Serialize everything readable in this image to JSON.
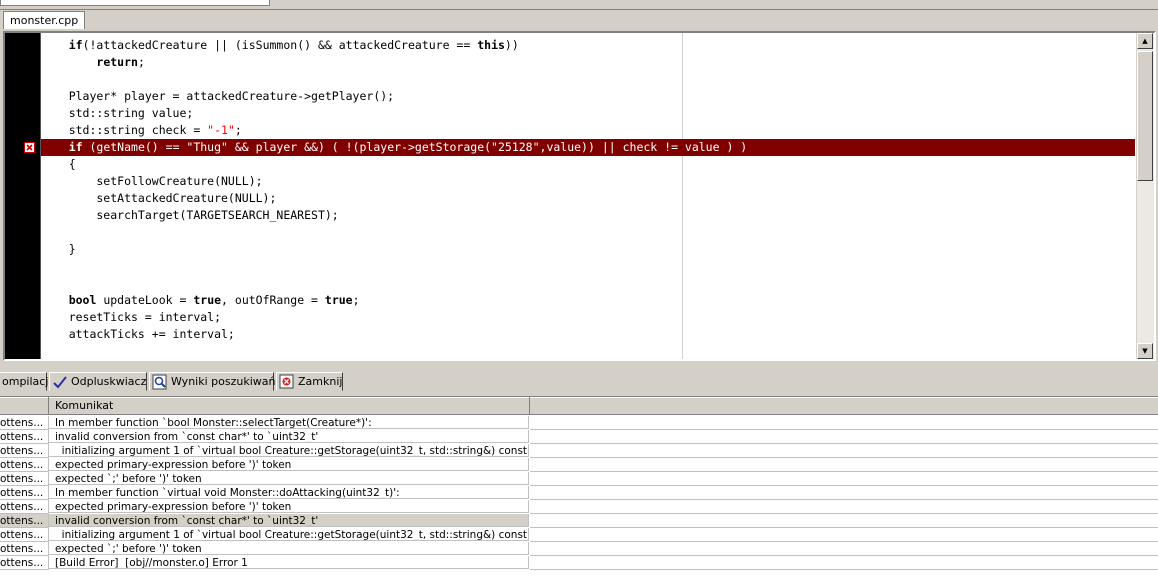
{
  "editor": {
    "file_tab": "monster.cpp",
    "lines": [
      {
        "segments": [
          {
            "t": "    "
          },
          {
            "t": "if",
            "kw": true
          },
          {
            "t": "(!attackedCreature || (isSummon() && attackedCreature == "
          },
          {
            "t": "this",
            "kw": true
          },
          {
            "t": "))"
          }
        ]
      },
      {
        "segments": [
          {
            "t": "        "
          },
          {
            "t": "return",
            "kw": true
          },
          {
            "t": ";"
          }
        ]
      },
      {
        "segments": [
          {
            "t": ""
          }
        ]
      },
      {
        "segments": [
          {
            "t": "    Player* player = attackedCreature->getPlayer();"
          }
        ]
      },
      {
        "segments": [
          {
            "t": "    std::string value;"
          }
        ]
      },
      {
        "segments": [
          {
            "t": "    std::string check = "
          },
          {
            "t": "\"-1\"",
            "str": true
          },
          {
            "t": ";"
          }
        ]
      },
      {
        "error": true,
        "segments": [
          {
            "t": "    "
          },
          {
            "t": "if",
            "kw": true
          },
          {
            "t": " (getName() == \"Thug\" && player &&) ( !(player->getStorage(\"25128\",value)) || check != value ) )"
          }
        ]
      },
      {
        "segments": [
          {
            "t": "    {"
          }
        ]
      },
      {
        "segments": [
          {
            "t": "        setFollowCreature(NULL);"
          }
        ]
      },
      {
        "segments": [
          {
            "t": "        setAttackedCreature(NULL);"
          }
        ]
      },
      {
        "segments": [
          {
            "t": "        searchTarget(TARGETSEARCH_NEAREST);"
          }
        ]
      },
      {
        "segments": [
          {
            "t": ""
          }
        ]
      },
      {
        "segments": [
          {
            "t": "    }"
          }
        ]
      },
      {
        "segments": [
          {
            "t": ""
          }
        ]
      },
      {
        "segments": [
          {
            "t": ""
          }
        ]
      },
      {
        "segments": [
          {
            "t": "    "
          },
          {
            "t": "bool",
            "kw": true
          },
          {
            "t": " updateLook = "
          },
          {
            "t": "true",
            "kw": true
          },
          {
            "t": ", outOfRange = "
          },
          {
            "t": "true",
            "kw": true
          },
          {
            "t": ";"
          }
        ]
      },
      {
        "segments": [
          {
            "t": "    resetTicks = interval;"
          }
        ]
      },
      {
        "segments": [
          {
            "t": "    attackTicks += interval;"
          }
        ]
      }
    ]
  },
  "bottom_tabs": [
    {
      "label": "ompilacji",
      "icon": "compile-icon"
    },
    {
      "label": "Odpluskwiacz",
      "icon": "check-icon"
    },
    {
      "label": "Wyniki poszukiwań",
      "icon": "search-results-icon"
    },
    {
      "label": "Zamknij",
      "icon": "close-icon"
    }
  ],
  "messages": {
    "columns": [
      "",
      "Komunikat"
    ],
    "rows": [
      {
        "c1": "ottens...",
        "c2": "In member function `bool Monster::selectTarget(Creature*)':"
      },
      {
        "c1": "ottens...",
        "c2": "invalid conversion from `const char*' to `uint32_t'"
      },
      {
        "c1": "ottens...",
        "c2": "  initializing argument 1 of `virtual bool Creature::getStorage(uint32_t, std::string&) const'"
      },
      {
        "c1": "ottens...",
        "c2": "expected primary-expression before ')' token"
      },
      {
        "c1": "ottens...",
        "c2": "expected `;' before ')' token"
      },
      {
        "c1": "ottens...",
        "c2": "In member function `virtual void Monster::doAttacking(uint32_t)':"
      },
      {
        "c1": "ottens...",
        "c2": "expected primary-expression before ')' token"
      },
      {
        "c1": "ottens...",
        "c2": "invalid conversion from `const char*' to `uint32_t'",
        "selected": true
      },
      {
        "c1": "ottens...",
        "c2": "  initializing argument 1 of `virtual bool Creature::getStorage(uint32_t, std::string&) const'"
      },
      {
        "c1": "ottens...",
        "c2": "expected `;' before ')' token"
      },
      {
        "c1": "ottens...",
        "c2": "[Build Error]  [obj//monster.o] Error 1"
      }
    ]
  },
  "colors": {
    "error_line_bg": "#800000",
    "selected_row_bg": "#d4d0c8",
    "gutter": "#000000"
  }
}
